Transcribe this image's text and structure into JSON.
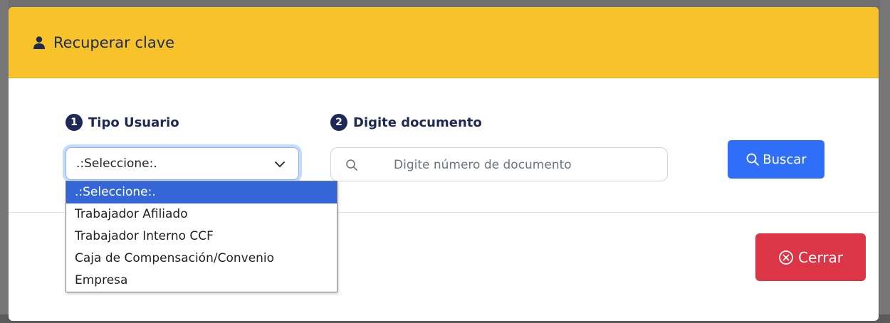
{
  "modal": {
    "title": "Recuperar clave",
    "header_color": "#f7c22a"
  },
  "form": {
    "step1": {
      "number": "1",
      "label": "Tipo Usuario"
    },
    "step2": {
      "number": "2",
      "label": "Digite documento"
    },
    "select": {
      "selected_value": ".:Seleccione:.",
      "options": [
        ".:Seleccione:.",
        "Trabajador Afiliado",
        "Trabajador Interno CCF",
        "Caja de Compensación/Convenio",
        "Empresa"
      ],
      "highlighted_index": 0
    },
    "document_input": {
      "value": "",
      "placeholder": "Digite número de documento"
    },
    "search_button": {
      "label": "Buscar",
      "icon": "search-icon",
      "color": "#2f6ff7"
    }
  },
  "footer": {
    "close_button": {
      "label": "Cerrar",
      "icon": "close-circle-icon",
      "color": "#dc3545"
    }
  }
}
